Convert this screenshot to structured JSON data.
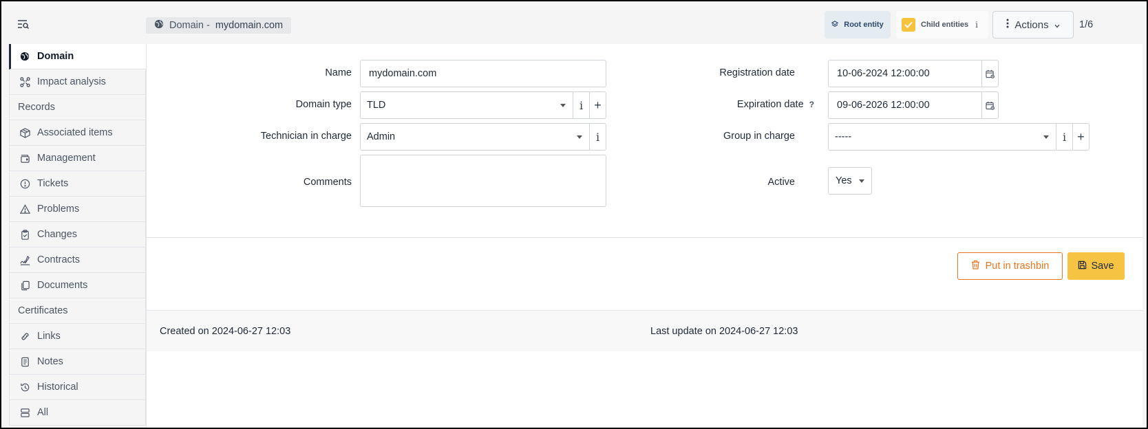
{
  "header": {
    "breadcrumb_prefix": "Domain -",
    "breadcrumb_title": "mydomain.com",
    "root_entity_label": "Root entity",
    "child_entities_label": "Child entities",
    "child_entities_info": "i",
    "actions_label": "Actions",
    "pager": "1/6"
  },
  "sidebar": {
    "items": [
      {
        "label": "Domain",
        "icon": "globe-icon",
        "active": true
      },
      {
        "label": "Impact analysis",
        "icon": "graph-icon"
      },
      {
        "label": "Records",
        "icon": "",
        "header": true
      },
      {
        "label": "Associated items",
        "icon": "package-icon"
      },
      {
        "label": "Management",
        "icon": "wallet-icon"
      },
      {
        "label": "Tickets",
        "icon": "alert-circle-icon"
      },
      {
        "label": "Problems",
        "icon": "alert-triangle-icon"
      },
      {
        "label": "Changes",
        "icon": "clipboard-check-icon"
      },
      {
        "label": "Contracts",
        "icon": "signature-icon"
      },
      {
        "label": "Documents",
        "icon": "files-icon"
      },
      {
        "label": "Certificates",
        "icon": "",
        "header": true
      },
      {
        "label": "Links",
        "icon": "link-icon"
      },
      {
        "label": "Notes",
        "icon": "notes-icon"
      },
      {
        "label": "Historical",
        "icon": "history-icon"
      },
      {
        "label": "All",
        "icon": "list-icon"
      }
    ]
  },
  "form": {
    "name_label": "Name",
    "name_value": "mydomain.com",
    "domain_type_label": "Domain type",
    "domain_type_value": "TLD",
    "technician_label": "Technician in charge",
    "technician_value": "Admin",
    "comments_label": "Comments",
    "comments_value": "",
    "registration_label": "Registration date",
    "registration_value": "10-06-2024 12:00:00",
    "expiration_label": "Expiration date",
    "expiration_help": "?",
    "expiration_value": "09-06-2026 12:00:00",
    "group_label": "Group in charge",
    "group_value": "-----",
    "active_label": "Active",
    "active_value": "Yes",
    "info_glyph": "i",
    "plus_glyph": "+"
  },
  "actions": {
    "trash_label": "Put in trashbin",
    "save_label": "Save"
  },
  "footer": {
    "created": "Created on 2024-06-27 12:03",
    "updated": "Last update on 2024-06-27 12:03"
  },
  "colors": {
    "accent": "#f7c343",
    "danger": "#e8741f",
    "root_bg": "#e4ebf1"
  }
}
